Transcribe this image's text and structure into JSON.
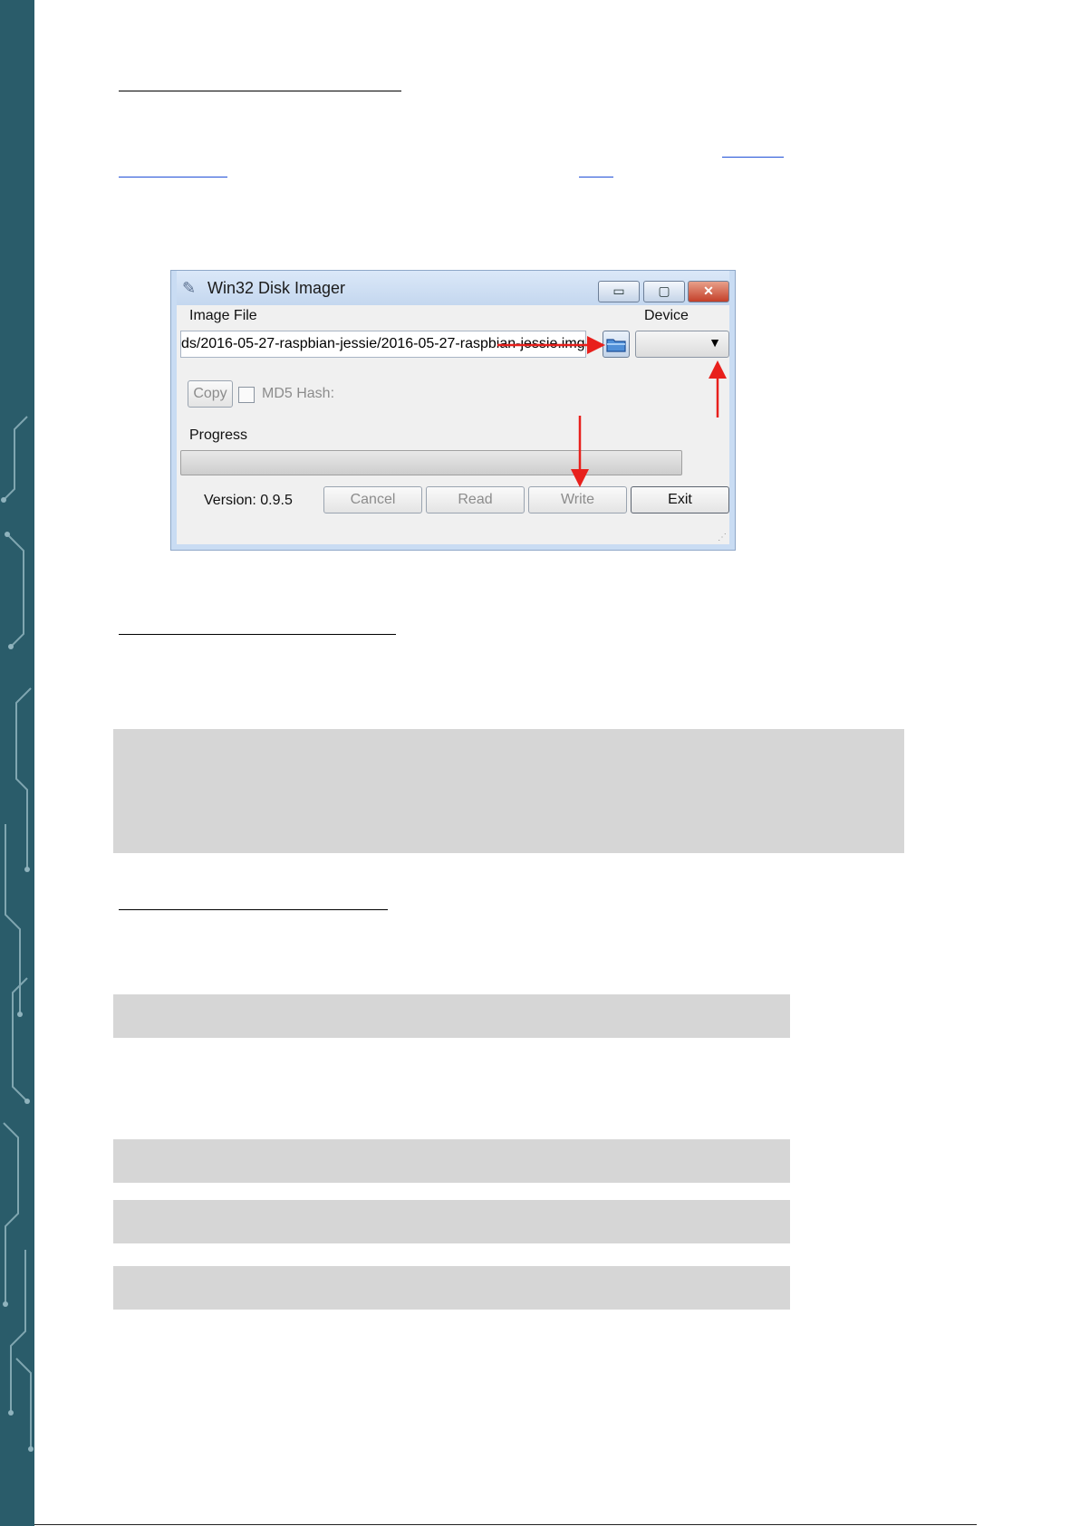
{
  "app": {
    "title": "Win32 Disk Imager",
    "window_controls": {
      "minimize": "▭",
      "maximize": "▢",
      "close": "✕"
    },
    "image_file_label": "Image File",
    "image_file_value": "ds/2016-05-27-raspbian-jessie/2016-05-27-raspbian-jessie.img",
    "device_label": "Device",
    "device_value": "",
    "copy_label": "Copy",
    "md5_label": "MD5 Hash:",
    "md5_checked": false,
    "progress_label": "Progress",
    "progress": 0,
    "version_text": "Version: 0.9.5",
    "buttons": {
      "cancel": "Cancel",
      "read": "Read",
      "write": "Write",
      "exit": "Exit"
    }
  },
  "icons": {
    "folder": "folder-icon",
    "app": "disk-imager-icon",
    "device_dropdown": "chevron-down-icon"
  },
  "colors": {
    "sidebar": "#2a5c6a",
    "annotation_arrow": "#e8201c",
    "link": "#1f4fd6",
    "placeholder_block": "#d6d6d6"
  }
}
